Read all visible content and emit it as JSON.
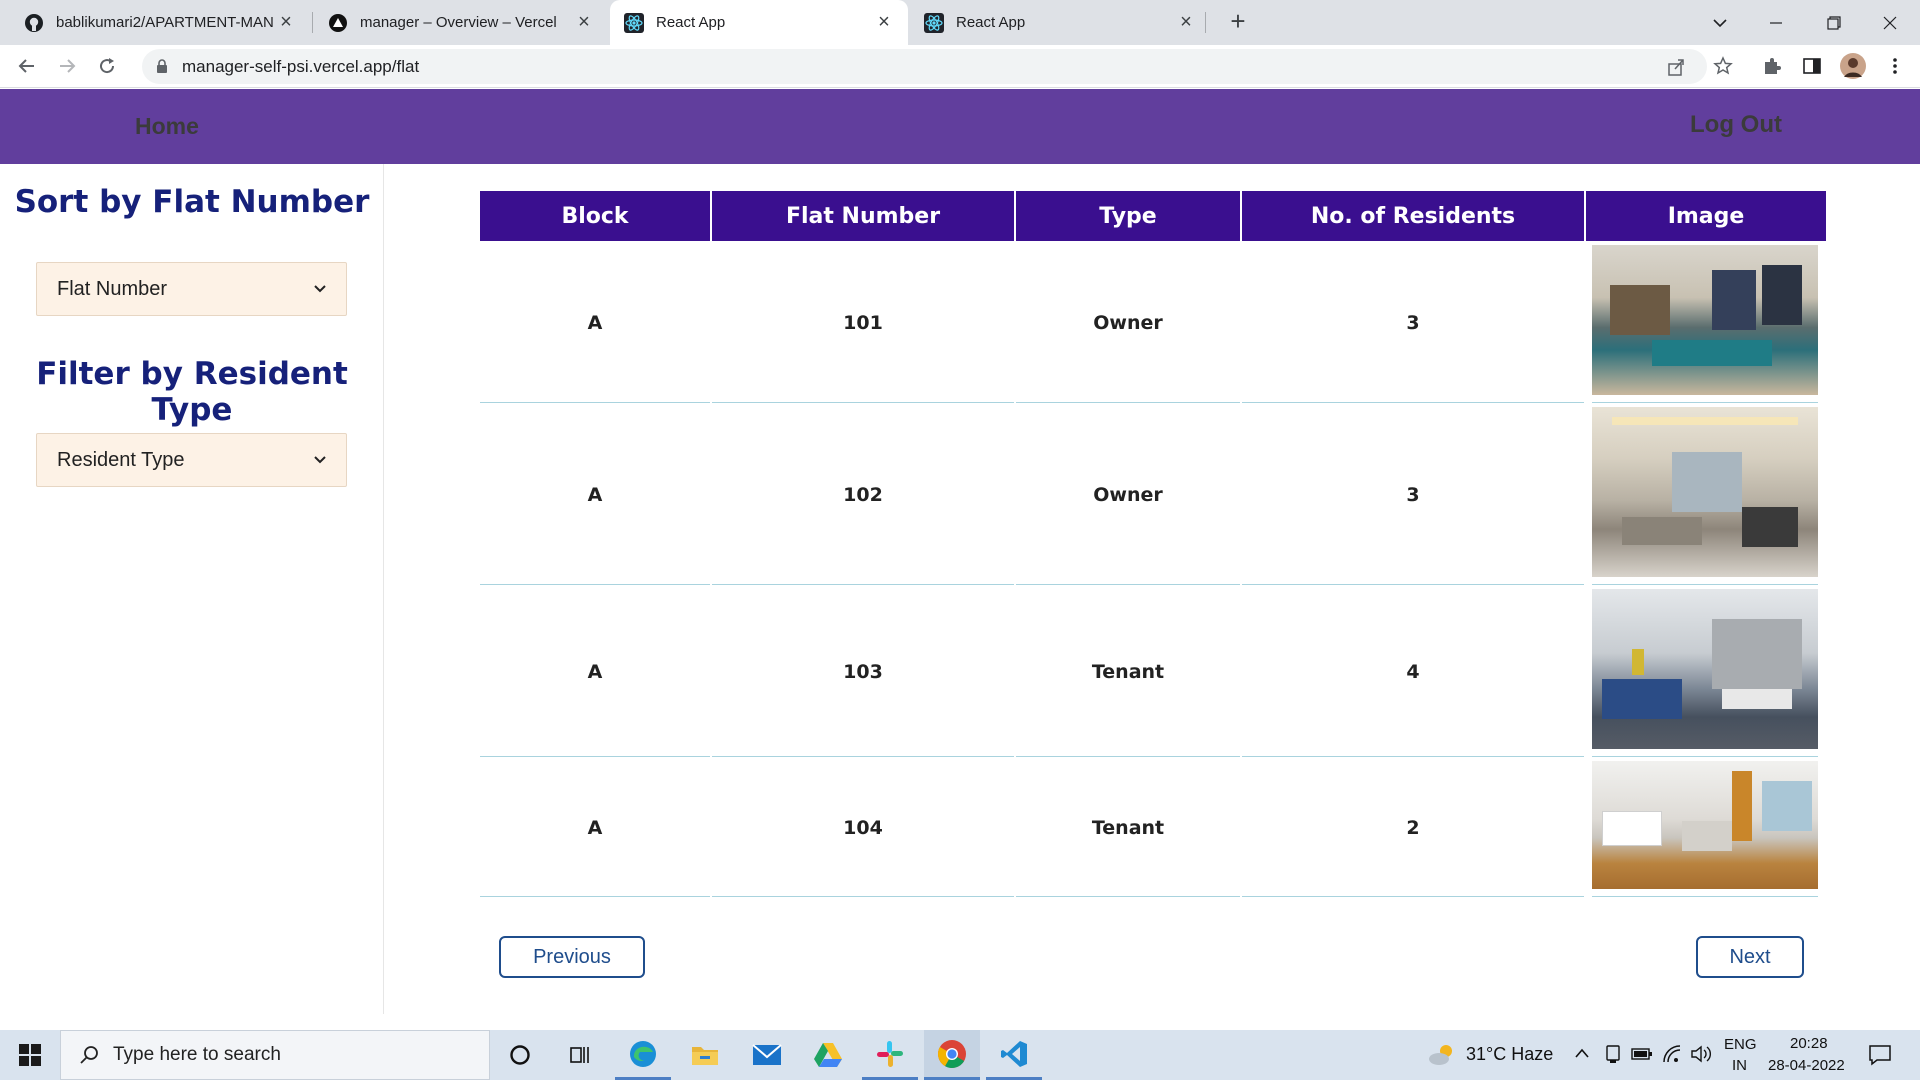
{
  "browser": {
    "tabs": [
      {
        "title": "bablikumari2/APARTMENT-MAN",
        "icon": "github-icon",
        "active": false
      },
      {
        "title": "manager – Overview – Vercel",
        "icon": "vercel-icon",
        "active": false
      },
      {
        "title": "React App",
        "icon": "react-icon",
        "active": true
      },
      {
        "title": "React App",
        "icon": "react-icon",
        "active": false
      }
    ],
    "url": "manager-self-psi.vercel.app/flat"
  },
  "nav": {
    "home": "Home",
    "logout": "Log Out",
    "background": "#613e9d"
  },
  "sidebar": {
    "sort_heading": "Sort by Flat Number",
    "sort_select": "Flat Number",
    "filter_heading": "Filter by Resident Type",
    "filter_select": "Resident Type"
  },
  "table": {
    "headers": [
      "Block",
      "Flat Number",
      "Type",
      "No. of Residents",
      "Image"
    ],
    "header_color": "#3a0f8f",
    "rows": [
      {
        "block": "A",
        "flat": "101",
        "type": "Owner",
        "residents": "3"
      },
      {
        "block": "A",
        "flat": "102",
        "type": "Owner",
        "residents": "3"
      },
      {
        "block": "A",
        "flat": "103",
        "type": "Tenant",
        "residents": "4"
      },
      {
        "block": "A",
        "flat": "104",
        "type": "Tenant",
        "residents": "2"
      }
    ]
  },
  "pagination": {
    "previous": "Previous",
    "next": "Next"
  },
  "taskbar": {
    "search_placeholder": "Type here to search",
    "weather": "31°C  Haze",
    "lang_top": "ENG",
    "lang_bottom": "IN",
    "time": "20:28",
    "date": "28-04-2022"
  }
}
